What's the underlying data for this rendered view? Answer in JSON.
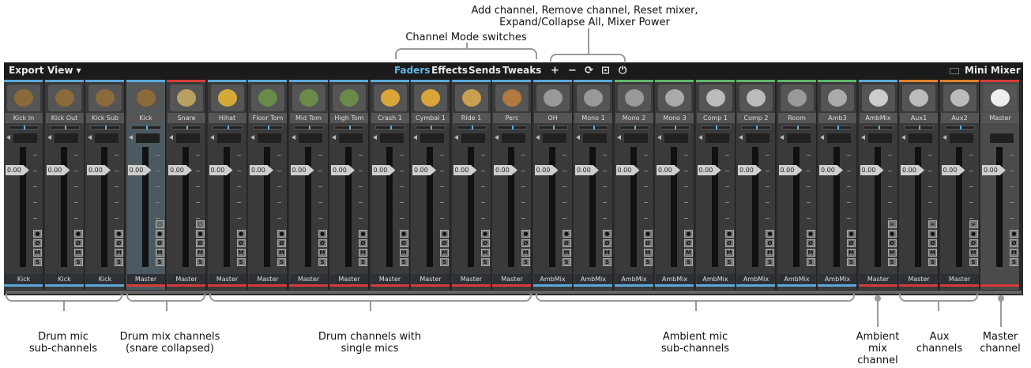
{
  "annotations": {
    "toolbar_note_line1": "Add channel, Remove channel, Reset mixer,",
    "toolbar_note_line2": "Expand/Collapse All, Mixer Power",
    "mode_note": "Channel Mode switches",
    "drum_mic_sub": [
      "Drum mic",
      "sub-channels"
    ],
    "drum_mix": [
      "Drum mix channels",
      "(snare collapsed)"
    ],
    "drum_single": [
      "Drum channels with",
      "single mics"
    ],
    "ambient_sub": [
      "Ambient mic",
      "sub-channels"
    ],
    "ambient_mix": [
      "Ambient",
      "mix",
      "channel"
    ],
    "aux": [
      "Aux",
      "channels"
    ],
    "master": [
      "Master",
      "channel"
    ]
  },
  "toolbar": {
    "export": "Export",
    "view": "View ▾",
    "modes": [
      "Faders",
      "Effects",
      "Sends",
      "Tweaks"
    ],
    "active_mode": "Faders",
    "add_icon": "+",
    "remove_icon": "−",
    "reset_icon": "⟳",
    "expand_icon": "⊡",
    "power_icon": "⏻",
    "mini_mixer": "Mini Mixer"
  },
  "fader_value": "0.00",
  "buttons": {
    "record": "●",
    "phase": "Ø",
    "mute": "M",
    "solo": "S",
    "link": "∞",
    "expand": "○"
  },
  "colors": {
    "blue": "#5aa8d8",
    "red": "#d63a3a",
    "green": "#5db56a",
    "orange": "#e0822f",
    "accent": "#5fb7e6"
  },
  "channels": [
    {
      "name": "Kick In",
      "output": "Kick",
      "top": "blue",
      "out": "blue",
      "icon": "kick-drum-icon"
    },
    {
      "name": "Kick Out",
      "output": "Kick",
      "top": "blue",
      "out": "blue",
      "icon": "kick-drum-icon"
    },
    {
      "name": "Kick Sub",
      "output": "Kick",
      "top": "blue",
      "out": "blue",
      "icon": "kick-drum-icon"
    },
    {
      "name": "Kick",
      "output": "Master",
      "top": "blue",
      "out": "red",
      "icon": "kick-drum-icon",
      "highlight": true
    },
    {
      "name": "Snare",
      "output": "Master",
      "top": "red",
      "out": "red",
      "icon": "snare-drum-icon"
    },
    {
      "name": "Hihat",
      "output": "Master",
      "top": "blue",
      "out": "red",
      "icon": "hihat-icon"
    },
    {
      "name": "Floor Tom",
      "output": "Master",
      "top": "blue",
      "out": "red",
      "icon": "floor-tom-icon"
    },
    {
      "name": "Mid Tom",
      "output": "Master",
      "top": "blue",
      "out": "red",
      "icon": "tom-icon"
    },
    {
      "name": "High Tom",
      "output": "Master",
      "top": "blue",
      "out": "red",
      "icon": "tom-icon"
    },
    {
      "name": "Crash 1",
      "output": "Master",
      "top": "blue",
      "out": "red",
      "icon": "cymbal-icon"
    },
    {
      "name": "Cymbal 1",
      "output": "Master",
      "top": "blue",
      "out": "red",
      "icon": "cymbal-icon"
    },
    {
      "name": "Ride 1",
      "output": "Master",
      "top": "blue",
      "out": "red",
      "icon": "ride-cymbal-icon"
    },
    {
      "name": "Perc",
      "output": "Master",
      "top": "blue",
      "out": "red",
      "icon": "percussion-icon"
    },
    {
      "name": "OH",
      "output": "AmbMix",
      "top": "blue",
      "out": "blue",
      "icon": "mic-icon"
    },
    {
      "name": "Mono 1",
      "output": "AmbMix",
      "top": "blue",
      "out": "blue",
      "icon": "mic-icon"
    },
    {
      "name": "Mono 2",
      "output": "AmbMix",
      "top": "green",
      "out": "blue",
      "icon": "mic-icon"
    },
    {
      "name": "Mono 3",
      "output": "AmbMix",
      "top": "green",
      "out": "blue",
      "icon": "condenser-mic-icon"
    },
    {
      "name": "Comp 1",
      "output": "AmbMix",
      "top": "green",
      "out": "blue",
      "icon": "pencil-mic-icon"
    },
    {
      "name": "Comp 2",
      "output": "AmbMix",
      "top": "green",
      "out": "blue",
      "icon": "pencil-mic-icon"
    },
    {
      "name": "Room",
      "output": "AmbMix",
      "top": "green",
      "out": "blue",
      "icon": "mic-icon"
    },
    {
      "name": "Amb3",
      "output": "AmbMix",
      "top": "green",
      "out": "blue",
      "icon": "condenser-mic-icon"
    },
    {
      "name": "AmbMix",
      "output": "Master",
      "top": "blue",
      "out": "red",
      "icon": "mixer-icon"
    },
    {
      "name": "Aux1",
      "output": "Master",
      "top": "orange",
      "out": "red",
      "icon": "cable-icon"
    },
    {
      "name": "Aux2",
      "output": "Master",
      "top": "orange",
      "out": "red",
      "icon": "cable-icon"
    },
    {
      "name": "Master",
      "output": "",
      "top": "red",
      "out": "red",
      "icon": "reel-icon",
      "master": true
    }
  ]
}
